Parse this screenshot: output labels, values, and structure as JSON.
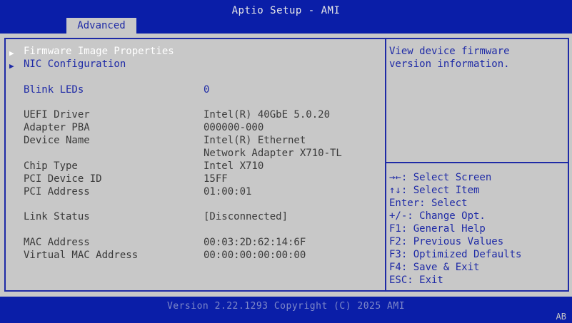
{
  "header": {
    "title": "Aptio Setup - AMI",
    "tab": "Advanced"
  },
  "menu": [
    {
      "label": "Firmware Image Properties",
      "selected": true
    },
    {
      "label": "NIC Configuration",
      "selected": false
    }
  ],
  "blink": {
    "label": "Blink LEDs",
    "value": "0"
  },
  "info": {
    "uefi_driver": {
      "label": "UEFI Driver",
      "value": "Intel(R) 40GbE 5.0.20"
    },
    "adapter_pba": {
      "label": "Adapter PBA",
      "value": "000000-000"
    },
    "device_name": {
      "label": "Device Name",
      "value_line1": "Intel(R) Ethernet",
      "value_line2": "Network Adapter X710-TL"
    },
    "chip_type": {
      "label": "Chip Type",
      "value": "Intel X710"
    },
    "pci_device_id": {
      "label": "PCI Device ID",
      "value": "15FF"
    },
    "pci_address": {
      "label": "PCI Address",
      "value": "01:00:01"
    },
    "link_status": {
      "label": "Link Status",
      "value": "[Disconnected]"
    },
    "mac_address": {
      "label": "MAC Address",
      "value": "00:03:2D:62:14:6F"
    },
    "virtual_mac": {
      "label": "Virtual MAC Address",
      "value": "00:00:00:00:00:00"
    }
  },
  "help": {
    "line1": "View device firmware",
    "line2": "version information."
  },
  "keys": [
    "→←: Select Screen",
    "↑↓: Select Item",
    "Enter: Select",
    "+/-: Change Opt.",
    "F1: General Help",
    "F2: Previous Values",
    "F3: Optimized Defaults",
    "F4: Save & Exit",
    "ESC: Exit"
  ],
  "footer": {
    "version": "Version 2.22.1293 Copyright (C) 2025 AMI",
    "corner": "AB"
  },
  "colors": {
    "bar": "#0a1ea8",
    "panel": "#c8c8c8",
    "accent": "#1e2aa6",
    "text": "#3a3a3a"
  }
}
